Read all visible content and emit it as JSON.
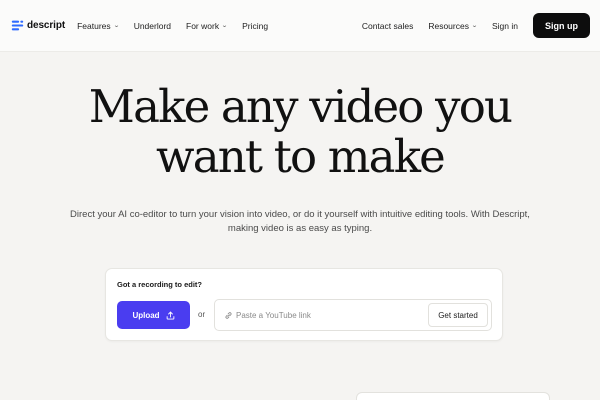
{
  "nav": {
    "brand": "descript",
    "items": [
      {
        "label": "Features",
        "has_dropdown": true
      },
      {
        "label": "Underlord",
        "has_dropdown": false
      },
      {
        "label": "For work",
        "has_dropdown": true
      },
      {
        "label": "Pricing",
        "has_dropdown": false
      }
    ],
    "right": {
      "contact_sales": "Contact sales",
      "resources": "Resources",
      "sign_in": "Sign in",
      "sign_up": "Sign up"
    },
    "chevron_glyph": "⌄"
  },
  "hero": {
    "headline_line1": "Make any video you",
    "headline_line2": "want to make",
    "subtitle": "Direct your AI co-editor to turn your vision into video, or do it yourself with intuitive editing tools. With Descript, making video is as easy as typing."
  },
  "card": {
    "title": "Got a recording to edit?",
    "upload_label": "Upload",
    "or_label": "or",
    "youtube_placeholder": "Paste a YouTube link",
    "get_started_label": "Get started"
  },
  "colors": {
    "accent": "#4a3df0",
    "background": "#f5f4f2",
    "brand_blue": "#2f6bff",
    "signup_bg": "#0d0d0d"
  },
  "icons": [
    "descript-logo-icon",
    "chevron-down-icon",
    "upload-icon",
    "link-icon"
  ]
}
